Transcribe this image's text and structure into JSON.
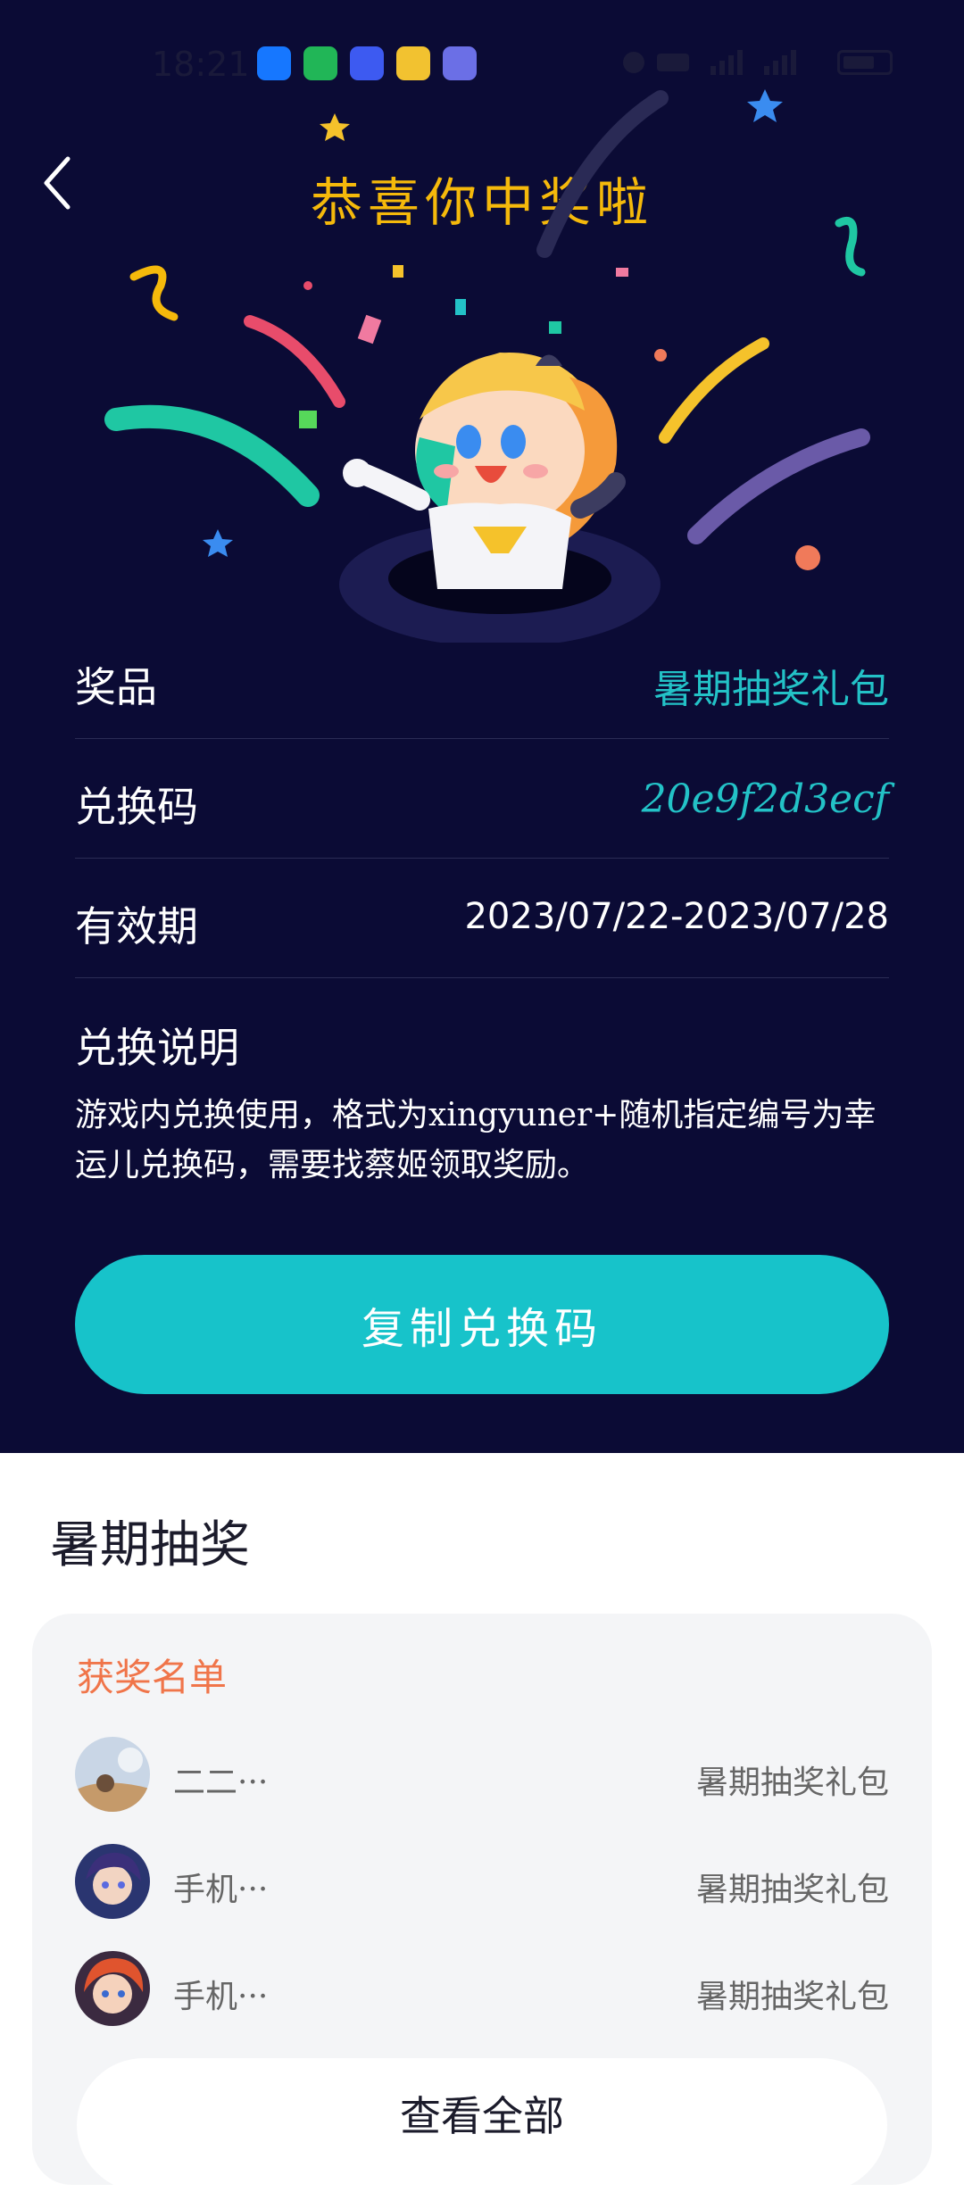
{
  "status_bar": {
    "time": "18:21",
    "app_icons": [
      "alipay-icon",
      "video-icon",
      "tieba-icon",
      "realme-icon",
      "game-icon"
    ]
  },
  "header": {
    "title": "恭喜你中奖啦",
    "back_icon": "chevron-left-icon"
  },
  "prize_info": {
    "prize_label": "奖品",
    "prize_value": "暑期抽奖礼包",
    "code_label": "兑换码",
    "code_value": "20e9f2d3ecf",
    "validity_label": "有效期",
    "validity_value": "2023/07/22-2023/07/28"
  },
  "instructions": {
    "title": "兑换说明",
    "text": "游戏内兑换使用，格式为xingyuner+随机指定编号为幸运儿兑换码，需要找蔡姬领取奖励。"
  },
  "copy_button": {
    "label": "复制兑换码"
  },
  "lottery": {
    "section_title": "暑期抽奖",
    "winners_title": "获奖名单",
    "winners": [
      {
        "name": "二二···",
        "prize": "暑期抽奖礼包"
      },
      {
        "name": "手机···",
        "prize": "暑期抽奖礼包"
      },
      {
        "name": "手机···",
        "prize": "暑期抽奖礼包"
      }
    ],
    "view_all_label": "查看全部"
  },
  "colors": {
    "background_dark": "#0b0b35",
    "accent_teal": "#17c3ca",
    "title_gold": "#f5b90b",
    "winners_orange": "#f0754a"
  }
}
